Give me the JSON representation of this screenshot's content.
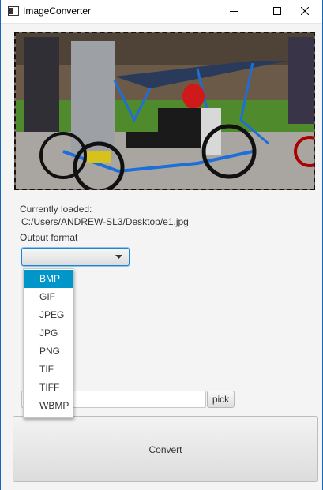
{
  "window": {
    "title": "ImageConverter",
    "accent_color": "#1566b8"
  },
  "preview": {
    "icon": "photo-image",
    "description_colors": [
      "#7a6a5a",
      "#1e6ed8",
      "#d01a1a"
    ]
  },
  "status": {
    "currently_loaded_label": "Currently loaded:",
    "file_path": "C:/Users/ANDREW-SL3/Desktop/e1.jpg"
  },
  "format": {
    "label": "Output format",
    "selected_value": "",
    "options": [
      "BMP",
      "GIF",
      "JPEG",
      "JPG",
      "PNG",
      "TIF",
      "TIFF",
      "WBMP"
    ],
    "highlighted_option": "BMP"
  },
  "destination": {
    "value": "",
    "pick_label": "pick"
  },
  "actions": {
    "convert_label": "Convert"
  }
}
